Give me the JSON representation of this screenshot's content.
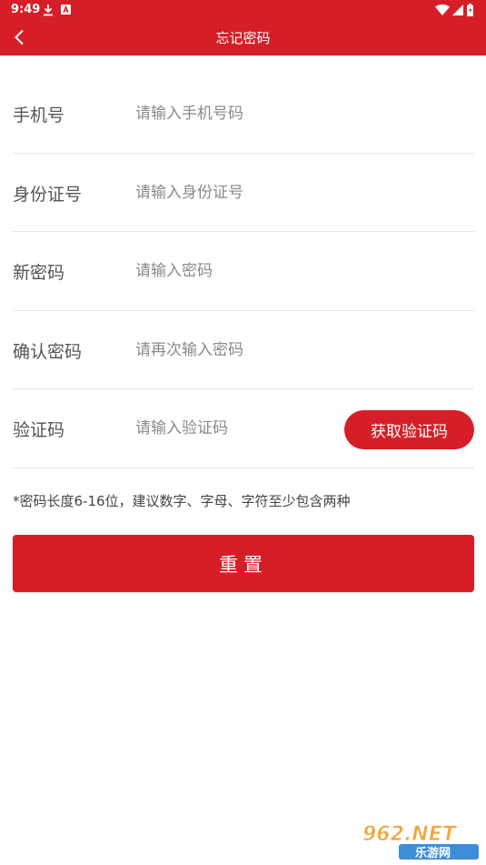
{
  "status_bar": {
    "time": "9:49",
    "icons": [
      "download-icon",
      "a-icon",
      "wifi-icon",
      "signal-icon",
      "battery-icon"
    ]
  },
  "title_bar": {
    "title": "忘记密码",
    "back_icon": "chevron-left-icon"
  },
  "form": {
    "rows": [
      {
        "label": "手机号",
        "placeholder": "请输入手机号码",
        "value": ""
      },
      {
        "label": "身份证号",
        "placeholder": "请输入身份证号",
        "value": ""
      },
      {
        "label": "新密码",
        "placeholder": "请输入密码",
        "value": ""
      },
      {
        "label": "确认密码",
        "placeholder": "请再次输入密码",
        "value": ""
      },
      {
        "label": "验证码",
        "placeholder": "请输入验证码",
        "value": ""
      }
    ],
    "get_code_label": "获取验证码"
  },
  "hint": "*密码长度6-16位，建议数字、字母、字符至少包含两种",
  "reset_label": "重置",
  "watermark": {
    "text_top": "962.NET",
    "text_bottom": "乐游网"
  },
  "colors": {
    "brand_red": "#d61e28",
    "divider": "#e6e6e6",
    "label_text": "#555555",
    "placeholder_text": "#8a8a8a"
  }
}
